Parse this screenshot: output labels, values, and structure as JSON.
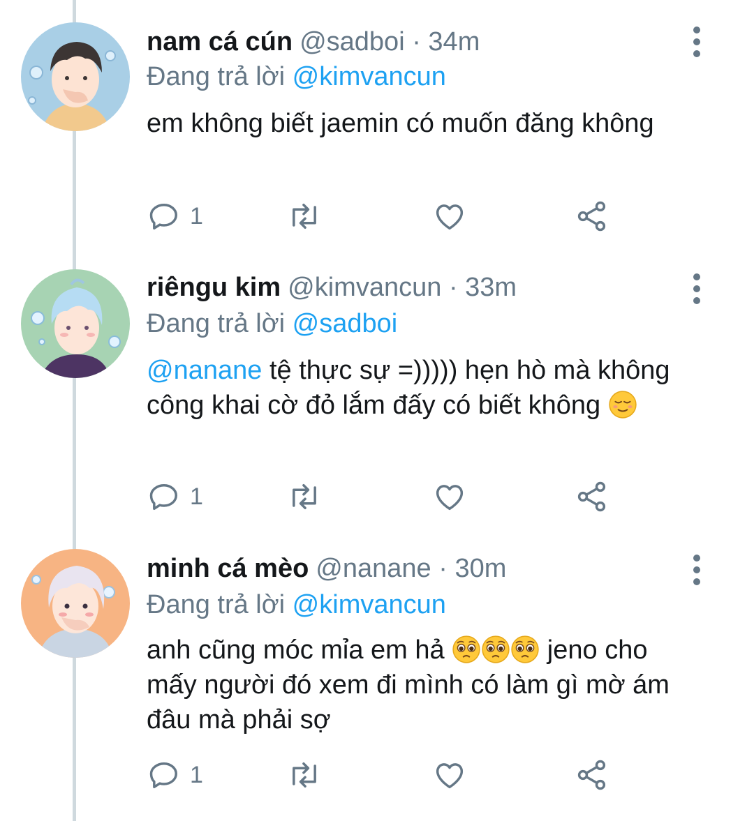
{
  "tweets": [
    {
      "display_name": "nam cá cún",
      "handle": "@sadboi",
      "separator": "·",
      "time": "34m",
      "reply_prefix": "Đang trả lời",
      "reply_to": "@kimvancun",
      "text": "em không biết jaemin có muốn đăng không",
      "reply_count": "1",
      "avatar_bg": "#a9cfe6"
    },
    {
      "display_name": "riêngu kim",
      "handle": "@kimvancun",
      "separator": "·",
      "time": "33m",
      "reply_prefix": "Đang trả lời",
      "reply_to": "@sadboi",
      "text_mention": "@nanane",
      "text": " tệ thực sự =))))) hẹn hò mà không công khai cờ đỏ lắm đấy có biết không ",
      "reply_count": "1",
      "avatar_bg": "#a7d3b3"
    },
    {
      "display_name": "minh cá mèo",
      "handle": "@nanane",
      "separator": "·",
      "time": "30m",
      "reply_prefix": "Đang trả lời",
      "reply_to": "@kimvancun",
      "text_before": "anh cũng móc mỉa em hả ",
      "text_after": " jeno cho mấy người đó xem đi mình có làm gì mờ ám đâu mà phải sợ",
      "reply_count": "1",
      "avatar_bg": "#f7b483"
    }
  ],
  "icons": {
    "reply": "reply-icon",
    "retweet": "retweet-icon",
    "like": "heart-icon",
    "share": "share-icon",
    "more": "more-vertical-icon",
    "relieved": "relieved-face-emoji",
    "pleading": "pleading-face-emoji"
  },
  "colors": {
    "link": "#1da1f2",
    "secondary": "#657786",
    "text": "#14171a",
    "thread_line": "#cfd9de"
  }
}
